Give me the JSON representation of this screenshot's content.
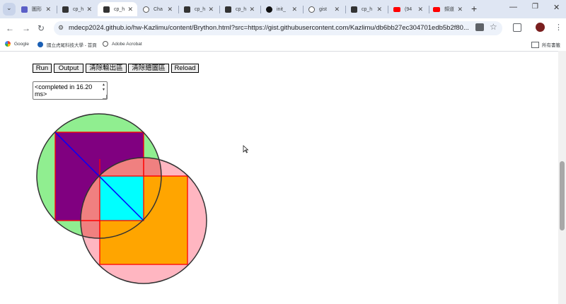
{
  "browser": {
    "tabs": [
      {
        "label": "圖形",
        "icon_color": "#5b5fc7"
      },
      {
        "label": "cp_h",
        "icon_color": "#333333"
      },
      {
        "label": "cp_h",
        "icon_color": "#333333",
        "active": true
      },
      {
        "label": "Cha",
        "icon_color": "#555555"
      },
      {
        "label": "cp_h",
        "icon_color": "#333333"
      },
      {
        "label": "cp_h",
        "icon_color": "#333333"
      },
      {
        "label": "init_",
        "icon_color": "#111111"
      },
      {
        "label": "gist",
        "icon_color": "#555555"
      },
      {
        "label": "cp_h",
        "icon_color": "#333333"
      },
      {
        "label": "(94",
        "icon_color": "#ff0000"
      },
      {
        "label": "頻道",
        "icon_color": "#ff0000"
      }
    ],
    "url": "mdecp2024.github.io/hw-Kazlimu/content/Brython.html?src=https://gist.githubusercontent.com/Kazlimu/db6bb27ec304701edb5b2f80...",
    "bookmarks": [
      {
        "label": "Google"
      },
      {
        "label": "國立虎尾科技大學 - 首頁"
      },
      {
        "label": "Adobe Acrobat"
      }
    ],
    "all_bookmarks": "所有書籤"
  },
  "page": {
    "buttons": [
      {
        "label": "Run"
      },
      {
        "label": "Output"
      },
      {
        "label": "清除輸出區"
      },
      {
        "label": "清除繪圖區"
      },
      {
        "label": "Reload"
      }
    ],
    "output_text": "<completed in 16.20 ms>"
  },
  "canvas": {
    "colors": {
      "circle1_fill": "#90ee90",
      "square1_fill": "#800080",
      "overlap_fill": "#f08080",
      "circle2_fill": "#ffb6c1",
      "square2_fill": "#ffa500",
      "overlap_square_fill": "#00ffff",
      "outline": "#ff0000",
      "diagonal": "#0000ff",
      "circle_border": "#333333"
    }
  }
}
